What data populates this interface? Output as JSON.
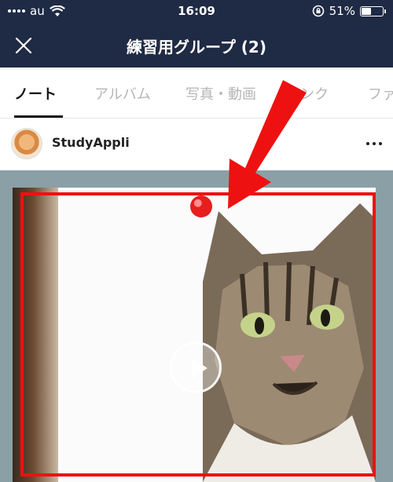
{
  "status_bar": {
    "carrier": "au",
    "time": "16:09",
    "battery_percent": "51%",
    "battery_level": 0.51
  },
  "header": {
    "title": "練習用グループ (2)"
  },
  "tabs": [
    {
      "label": "ノート"
    },
    {
      "label": "アルバム"
    },
    {
      "label": "写真・動画"
    },
    {
      "label": "リンク"
    },
    {
      "label": "ファ"
    }
  ],
  "post": {
    "author": "StudyAppli"
  },
  "colors": {
    "header_bg": "#1f2a44",
    "highlight": "#ee1111"
  }
}
